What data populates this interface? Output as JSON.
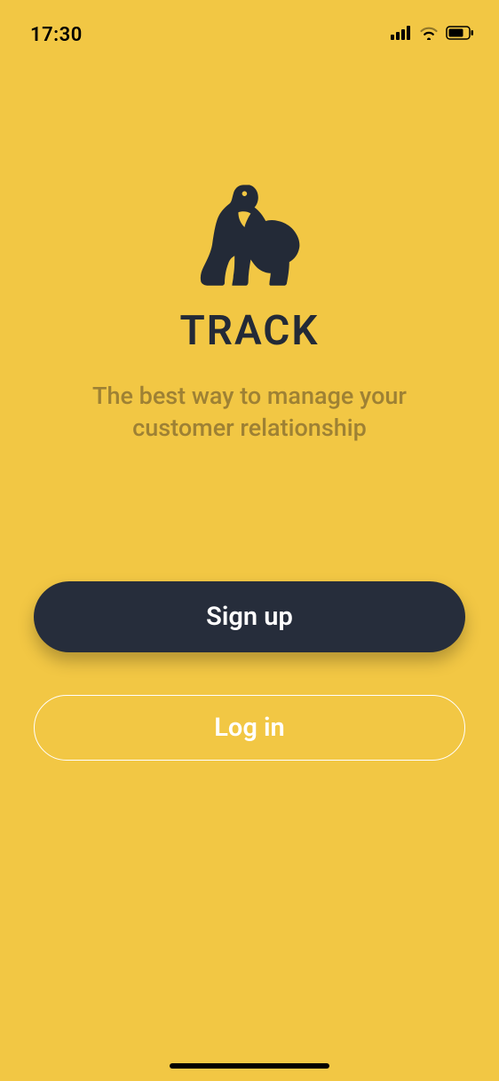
{
  "status": {
    "time": "17:30"
  },
  "brand": {
    "name": "TRACK",
    "tagline_line1": "The best way to manage your",
    "tagline_line2": "customer relationship"
  },
  "buttons": {
    "signup": "Sign up",
    "login": "Log in"
  },
  "colors": {
    "background": "#f2c744",
    "dark": "#262d3b",
    "muted": "#9e8134"
  }
}
